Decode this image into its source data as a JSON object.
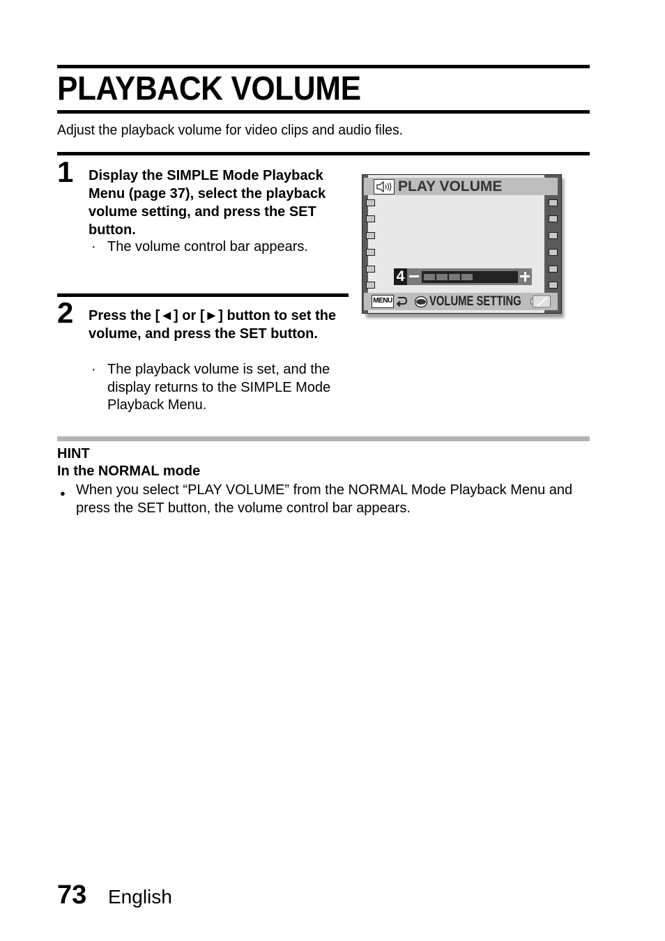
{
  "page": {
    "title": "PLAYBACK VOLUME",
    "intro": "Adjust the playback volume for video clips and audio files."
  },
  "steps": [
    {
      "number": "1",
      "instruction": "Display the SIMPLE Mode Playback Menu (page 37), select the playback volume setting, and press the SET button.",
      "bullets": [
        "The volume control bar appears."
      ]
    },
    {
      "number": "2",
      "instruction": "Press the [◄] or [►] button to set the volume, and press the SET button.",
      "bullets": [
        "The playback volume is set, and the display returns to the SIMPLE Mode Playback Menu."
      ]
    }
  ],
  "screen": {
    "title": "PLAY VOLUME",
    "title_icon": "speaker-icon",
    "volume": {
      "value_label": "4",
      "level": 4,
      "max_level": 10,
      "minus_label": "−",
      "plus_label": "+"
    },
    "status_bar": {
      "menu_label": "MENU",
      "return_icon": "return-arrow-icon",
      "dial_icon": "dial-icon",
      "text": "VOLUME SETTING",
      "battery_icon": "battery-icon"
    },
    "colors": {
      "frame": "#5a5a5a",
      "screen_bg": "#e8e8e8",
      "bar_bg": "#bdbdbd",
      "volume_bar": "#222222",
      "volume_segment": "#7a7a7a"
    }
  },
  "hint": {
    "label": "HINT",
    "subtitle": "In the NORMAL mode",
    "bullets": [
      "When you select “PLAY VOLUME” from the NORMAL Mode Playback Menu and press the SET button, the volume control bar appears."
    ]
  },
  "footer": {
    "page_number": "73",
    "language": "English"
  }
}
